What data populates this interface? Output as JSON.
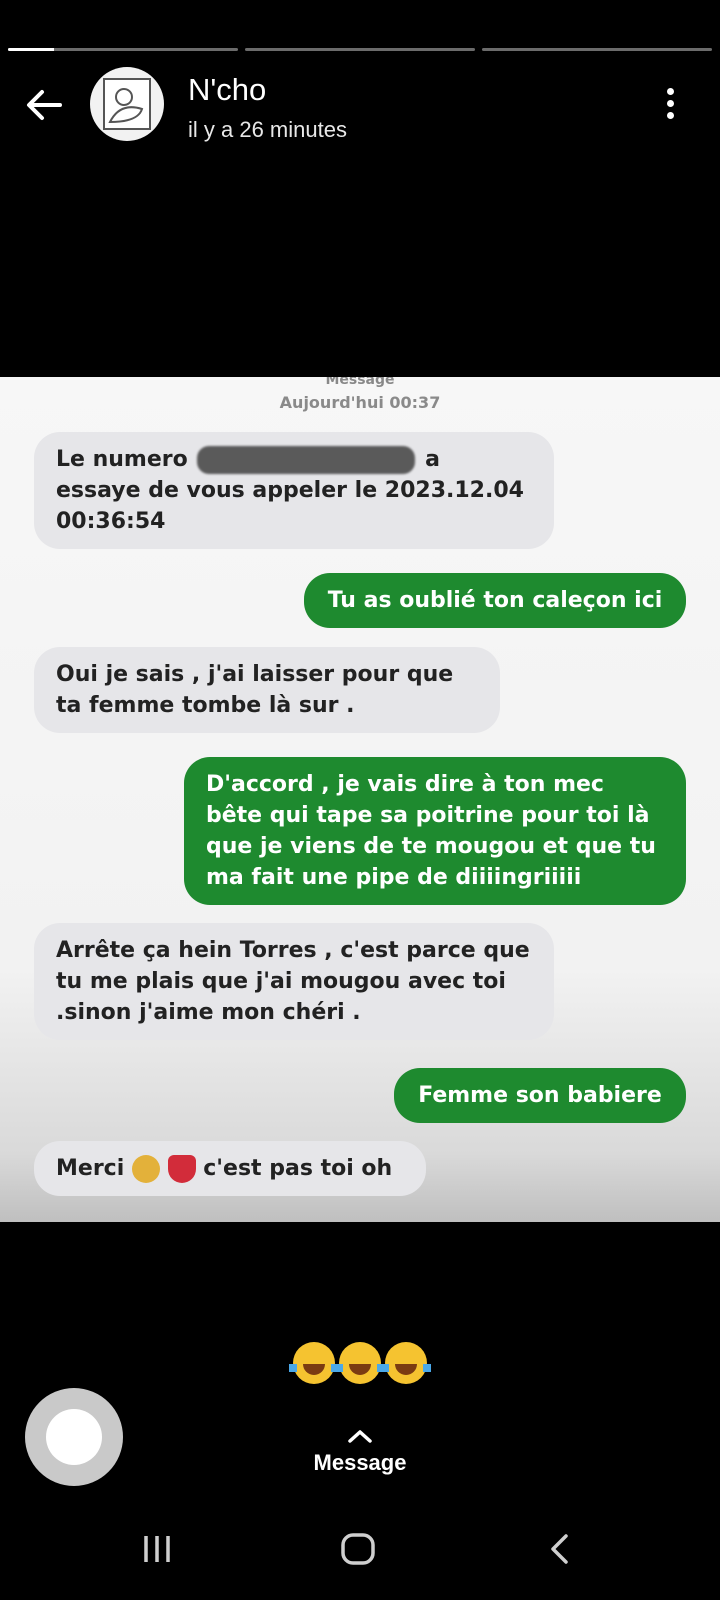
{
  "story": {
    "segments": [
      1,
      0,
      0
    ],
    "active_fraction": 0.2
  },
  "header": {
    "title": "N'cho",
    "subtitle": "il y a 26 minutes"
  },
  "screenshot": {
    "header_label": "Message",
    "header_time": "Aujourd'hui 00:37",
    "messages": [
      {
        "dir": "in",
        "text_before": "Le numero",
        "text_after": "a essaye",
        "text_rest": "de vous appeler le 2023.12.04 00:36:54"
      },
      {
        "dir": "out",
        "text": "Tu as oublié ton caleçon ici"
      },
      {
        "dir": "in",
        "text": "Oui je sais , j'ai laisser pour que ta femme tombe là sur ."
      },
      {
        "dir": "out",
        "text": "D'accord , je vais dire à ton mec bête qui tape sa poitrine pour toi là que je viens de te mougou et que tu ma fait une pipe de diiiingriiiii"
      },
      {
        "dir": "in",
        "text": "Arrête ça hein Torres , c'est parce que tu me plais que j'ai mougou avec toi .sinon j'aime mon chéri ."
      },
      {
        "dir": "out",
        "text": "Femme son babiere"
      },
      {
        "dir": "in",
        "text_before": "Merci",
        "text_after": "c'est pas toi oh"
      }
    ]
  },
  "reaction": "😂😂😂",
  "reply": {
    "label": "Message"
  },
  "colors": {
    "sent": "#1e8a2f",
    "received": "#e6e6e9"
  }
}
